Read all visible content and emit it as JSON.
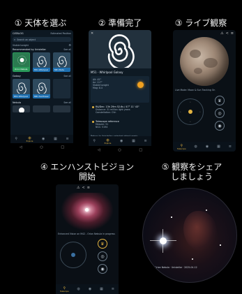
{
  "steps": [
    {
      "label": "① 天体を選ぶ"
    },
    {
      "label": "② 準備完了"
    },
    {
      "label": "③ ライブ観察"
    },
    {
      "label": "④ エンハンストビジョン\n開始"
    },
    {
      "label": "⑤ 観察をシェア\nしましょう"
    }
  ],
  "screen1": {
    "header_left": "CATALOG",
    "header_right": "Estimated Position",
    "search_placeholder": "Search an object",
    "location": "Visible tonight",
    "section_recommended": "Recommended by Unistellar",
    "see_all": "See all",
    "section_galaxy": "Galaxy",
    "section_nebula": "Nebula",
    "cards": [
      {
        "caption": "Orion Nebula"
      },
      {
        "caption": "M51 Whirlpool"
      },
      {
        "caption": "M81 Bode"
      }
    ],
    "galaxy_cards": [
      {
        "caption": "M51 Whirlpool"
      },
      {
        "caption": "M81 Sunflower"
      }
    ]
  },
  "screen2": {
    "object_title": "M51 - Whirlpool Galaxy",
    "info_lines": [
      "Alt: 45°",
      "Az: 117°",
      "Visible tonight",
      "Mag: 8.4"
    ],
    "detail_lines": [
      "RA/Dec: 13h 29m 52.6s / 47° 11' 43\"",
      "Distance: 31 million light years",
      "Constellation: CVn"
    ],
    "telescope_lines": [
      "Telescope reference",
      "Messier: 51",
      "NGC: 5194"
    ],
    "footer_note": "Return to Unistellar: selected object ready",
    "go_label": "GO"
  },
  "screen3": {
    "caption": "Live Mode: Moon & Sun Tracking On"
  },
  "screen4": {
    "caption": "Enhanced Vision on M42 - Orion Nebula in progress"
  },
  "screen5": {
    "watermark": "Orion Nebula · Unistellar · 2025-04-12"
  },
  "nav": {
    "items": [
      {
        "label": "Telescope",
        "icon": "telescope-icon"
      },
      {
        "label": "Explore",
        "icon": "planet-icon"
      },
      {
        "label": "Captures",
        "icon": "camera-icon"
      },
      {
        "label": "Events",
        "icon": "calendar-icon"
      },
      {
        "label": "More",
        "icon": "menu-icon"
      }
    ]
  },
  "colors": {
    "accent": "#e3b341",
    "blue": "#1d6fb0",
    "green": "#2a9a5a",
    "panel": "#0b1520"
  }
}
